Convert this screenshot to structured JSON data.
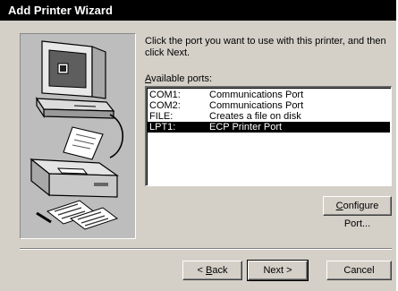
{
  "window": {
    "title": "Add Printer Wizard"
  },
  "instructions": "Click the port you want to use with this printer, and then click Next.",
  "ports": {
    "label_prefix": "",
    "label_accel": "A",
    "label_rest": "vailable ports:",
    "items": [
      {
        "name": "COM1:",
        "description": "Communications Port",
        "selected": false
      },
      {
        "name": "COM2:",
        "description": "Communications Port",
        "selected": false
      },
      {
        "name": "FILE:",
        "description": "Creates a file on disk",
        "selected": false
      },
      {
        "name": "LPT1:",
        "description": "ECP Printer Port",
        "selected": true
      }
    ]
  },
  "buttons": {
    "configure_accel": "C",
    "configure_rest": "onfigure Port...",
    "back_prefix": "< ",
    "back_accel": "B",
    "back_rest": "ack",
    "next": "Next >",
    "cancel": "Cancel"
  },
  "icons": [
    "computer-icon",
    "printer-icon",
    "document-pages-icon"
  ]
}
